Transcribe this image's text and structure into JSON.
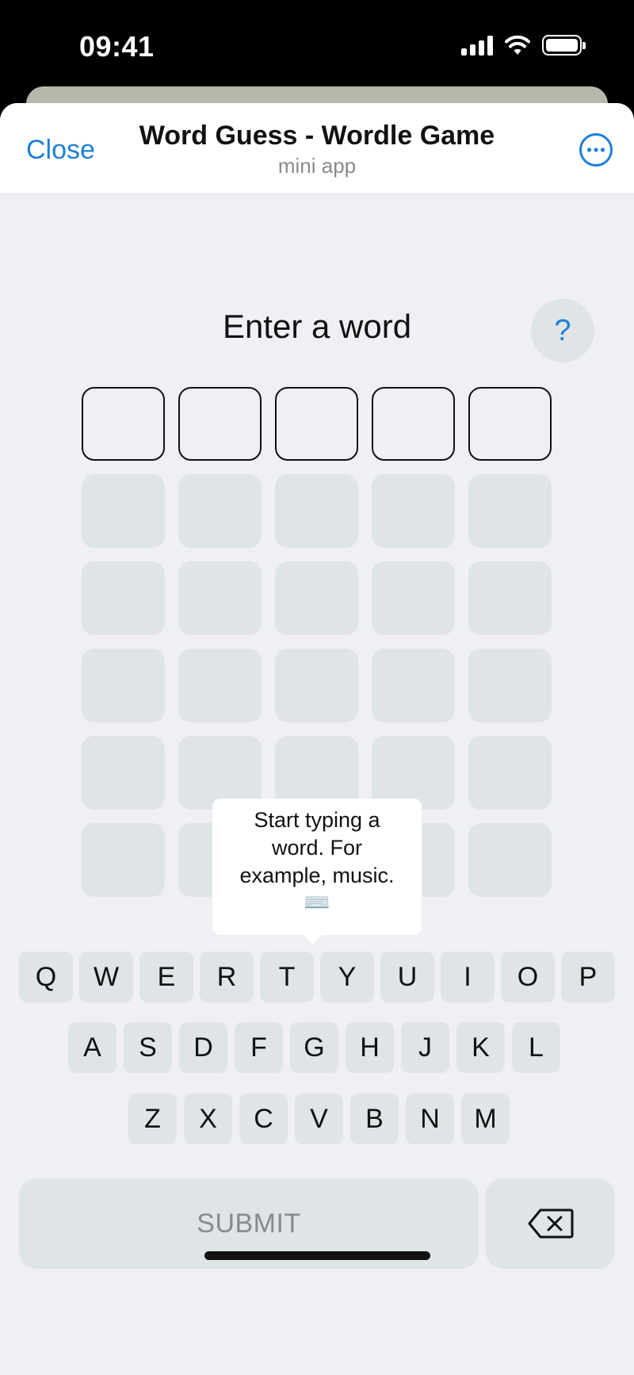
{
  "status_bar": {
    "time": "09:41",
    "icons": [
      "cellular-signal-icon",
      "wifi-icon",
      "battery-icon"
    ]
  },
  "nav": {
    "close_label": "Close",
    "title": "Word Guess - Wordle Game",
    "subtitle": "mini app",
    "more_icon": "ellipsis-circle-icon"
  },
  "game": {
    "prompt": "Enter a word",
    "help_label": "?",
    "rows": 6,
    "columns": 5,
    "active_row": 0
  },
  "tooltip": {
    "lines": [
      "Start typing a",
      "word. For",
      "example, music."
    ],
    "emoji": "⌨️"
  },
  "keyboard": {
    "row1": [
      "Q",
      "W",
      "E",
      "R",
      "T",
      "Y",
      "U",
      "I",
      "O",
      "P"
    ],
    "row2": [
      "A",
      "S",
      "D",
      "F",
      "G",
      "H",
      "J",
      "K",
      "L"
    ],
    "row3": [
      "Z",
      "X",
      "C",
      "V",
      "B",
      "N",
      "M"
    ],
    "submit_label": "SUBMIT",
    "backspace_icon": "backspace-icon"
  },
  "colors": {
    "accent": "#1e7fd8",
    "tile_empty": "#dfe4e6",
    "background": "#efeff4"
  }
}
